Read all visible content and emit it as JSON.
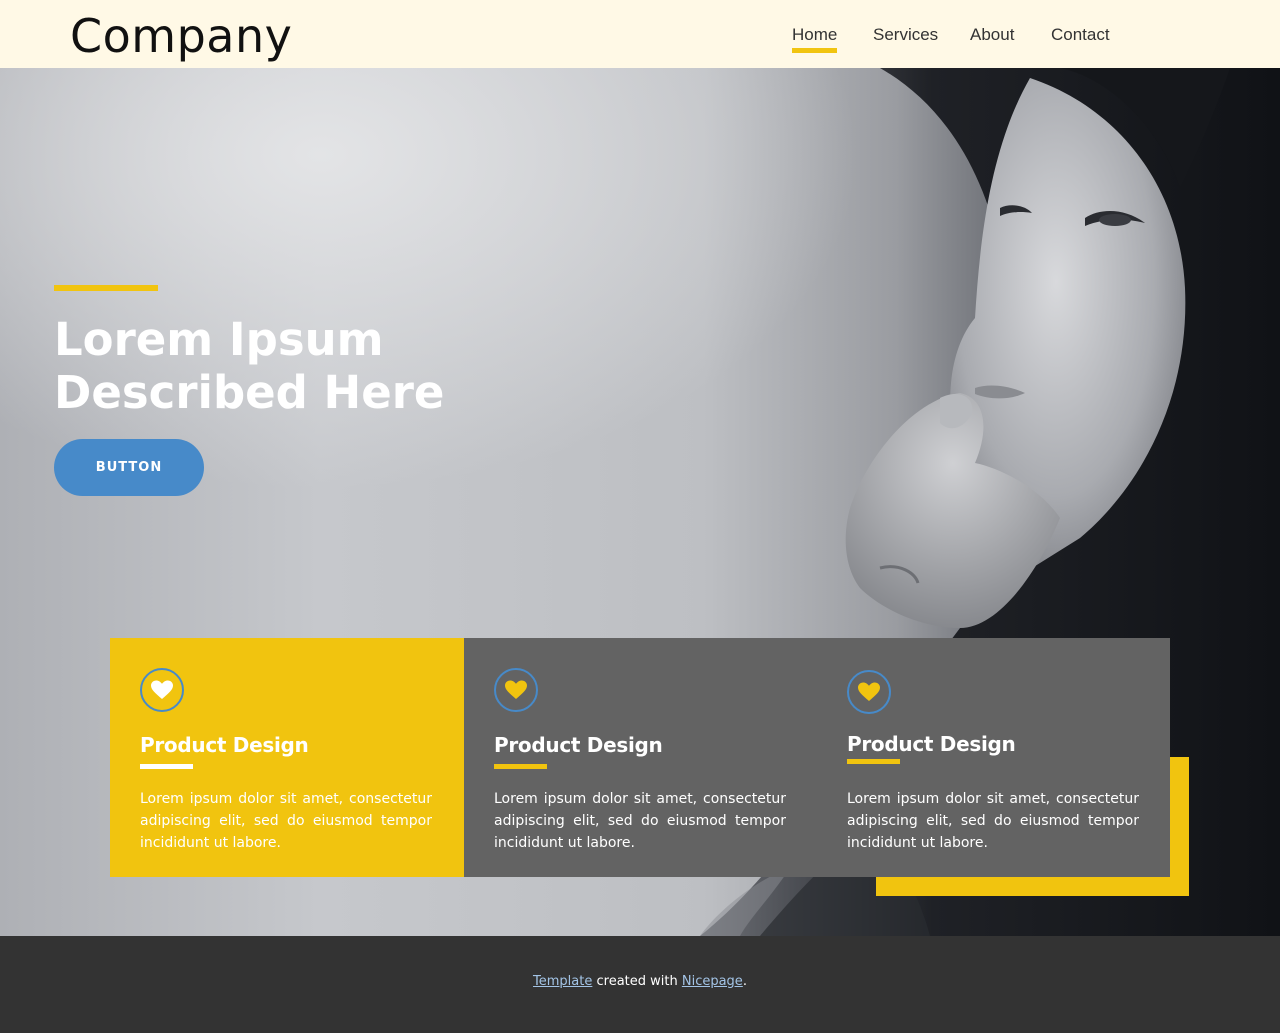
{
  "header": {
    "logo": "Company",
    "nav": [
      {
        "label": "Home",
        "active": true
      },
      {
        "label": "Services",
        "active": false
      },
      {
        "label": "About",
        "active": false
      },
      {
        "label": "Contact",
        "active": false
      }
    ]
  },
  "hero": {
    "title_line1": "Lorem Ipsum",
    "title_line2": "Described Here",
    "button_label": "BUTTON"
  },
  "cards": [
    {
      "icon": "heart-icon",
      "title": "Product Design",
      "text": "Lorem ipsum dolor sit amet, consectetur adipiscing elit, sed do eiusmod tempor incididunt ut labore."
    },
    {
      "icon": "heart-icon",
      "title": "Product Design",
      "text": "Lorem ipsum dolor sit amet, consectetur adipiscing elit, sed do eiusmod tempor incididunt ut labore."
    },
    {
      "icon": "heart-icon",
      "title": "Product Design",
      "text": "Lorem ipsum dolor sit amet, consectetur adipiscing elit, sed do eiusmod tempor incididunt ut labore."
    }
  ],
  "footer": {
    "link1": "Template",
    "middle": " created with ",
    "link2": "Nicepage",
    "end": "."
  },
  "colors": {
    "accent": "#f1c40f",
    "primary": "#478ac9",
    "card_dark": "#636363",
    "header_bg": "#fff9e6",
    "footer_bg": "#333333"
  }
}
